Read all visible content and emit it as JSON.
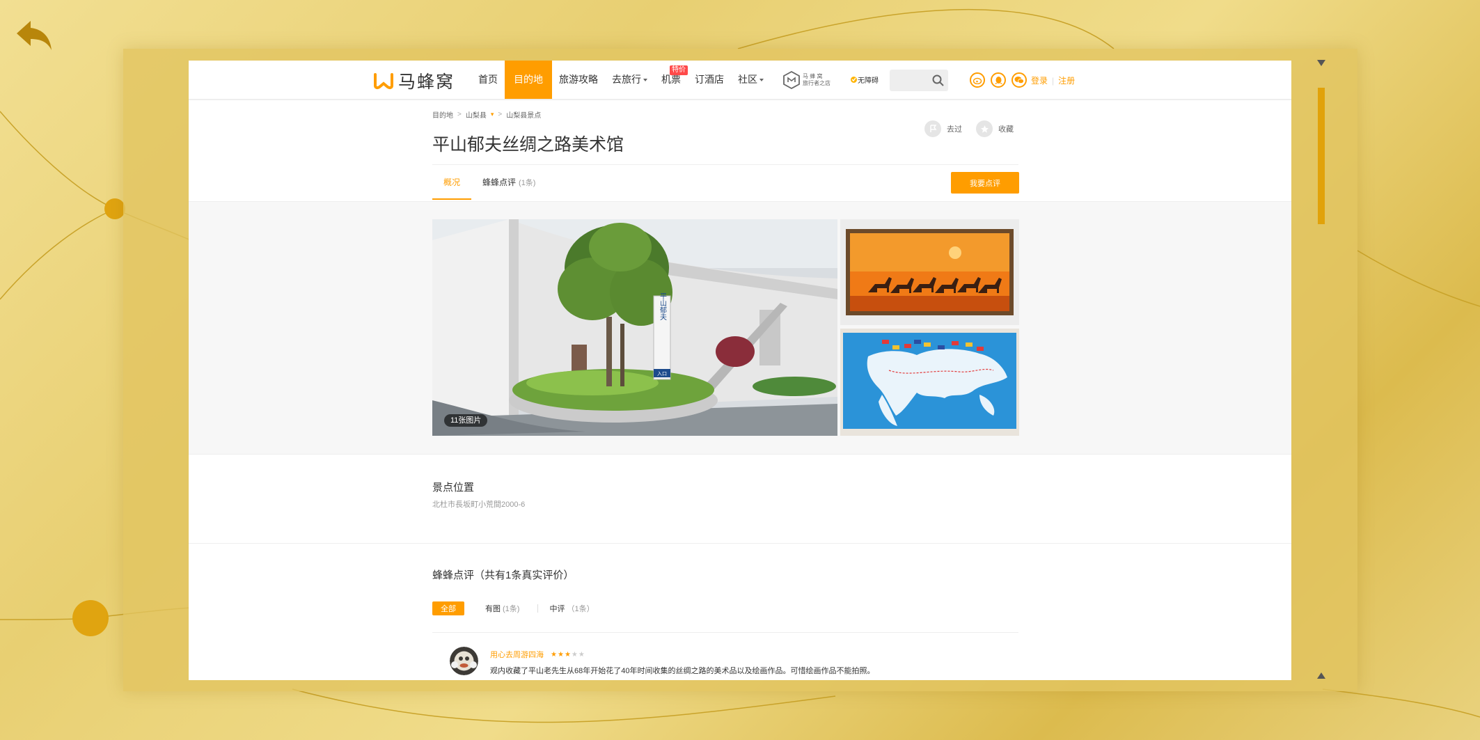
{
  "header": {
    "logo_text": "马蜂窝",
    "nav": [
      {
        "label": "首页",
        "active": false
      },
      {
        "label": "目的地",
        "active": true
      },
      {
        "label": "旅游攻略",
        "active": false
      },
      {
        "label": "去旅行",
        "active": false,
        "dropdown": true
      },
      {
        "label": "机票",
        "active": false,
        "badge": "特价"
      },
      {
        "label": "订酒店",
        "active": false
      },
      {
        "label": "社区",
        "active": false,
        "dropdown": true
      }
    ],
    "mfw_shop_line1": "马 蜂 窝",
    "mfw_shop_line2": "旅行者之店",
    "accessibility_label": "无障碍",
    "search_placeholder": "",
    "login": "登录",
    "register": "注册",
    "social_icons": [
      "weibo-icon",
      "qq-icon",
      "wechat-icon"
    ]
  },
  "breadcrumb": {
    "items": [
      "目的地",
      "山梨县",
      "山梨县景点"
    ]
  },
  "poi": {
    "title": "平山郁夫丝绸之路美术馆",
    "been_label": "去过",
    "favorite_label": "收藏"
  },
  "tabs": {
    "overview": "概况",
    "reviews": "蜂蜂点评",
    "reviews_count": "(1条)",
    "write_review": "我要点评"
  },
  "gallery": {
    "photo_count": "11张图片",
    "sign_text": "平山郁夫",
    "entrance_text": "入口"
  },
  "location": {
    "title": "景点位置",
    "address": "北杜市長坂町小荒間2000-6"
  },
  "reviews": {
    "title": "蜂蜂点评（共有1条真实评价）",
    "filters": [
      {
        "label": "全部",
        "count": "",
        "active": true
      },
      {
        "label": "有图",
        "count": "(1条)",
        "active": false
      },
      {
        "label": "中评",
        "count": "（1条）",
        "active": false
      }
    ],
    "items": [
      {
        "username": "用心去周游四海",
        "rating": 3,
        "max_rating": 5,
        "text": "观内收藏了平山老先生从68年开始花了40年时间收集的丝绸之路的美术品以及绘画作品。可惜绘画作品不能拍照。"
      }
    ]
  },
  "colors": {
    "accent": "#ff9d00",
    "scroll_thumb": "#e1a20a",
    "badge": "#ff4a4a"
  }
}
